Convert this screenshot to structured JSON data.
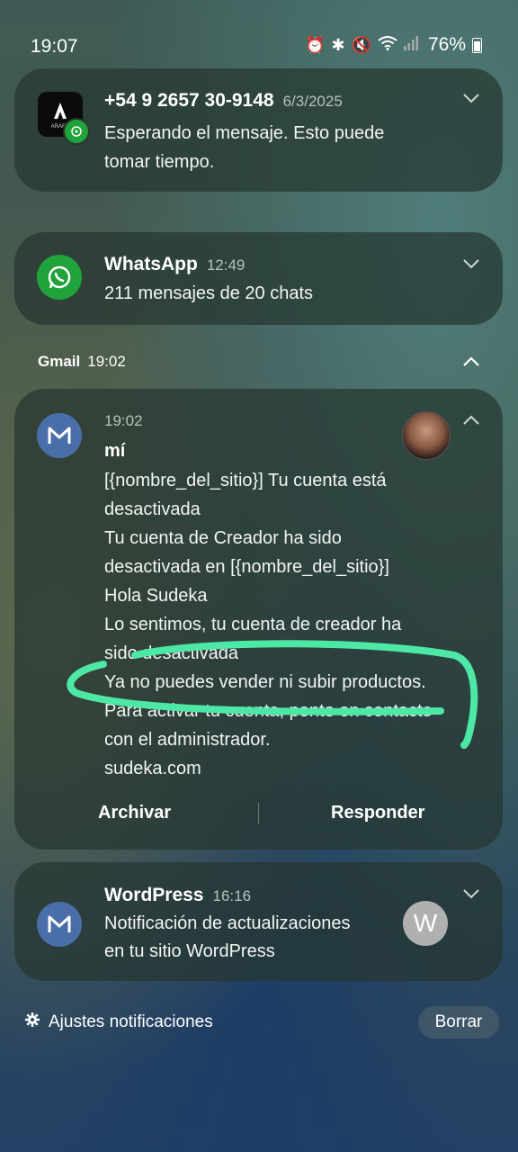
{
  "status_bar": {
    "time": "19:07",
    "battery": "76%",
    "icons": [
      "alarm-icon",
      "bluetooth-icon",
      "mute-icon",
      "wifi-icon",
      "signal-icon",
      "battery-icon"
    ]
  },
  "notifications": {
    "sms": {
      "app_icon": "arara-app-icon",
      "sender": "+54 9 2657 30-9148",
      "date": "6/3/2025",
      "body_lines": [
        "Esperando el mensaje. Esto puede",
        "tomar tiempo."
      ]
    },
    "whatsapp": {
      "app_name": "WhatsApp",
      "time": "12:49",
      "body": "211 mensajes de 20 chats"
    },
    "gmail_group": {
      "app_name": "Gmail",
      "time": "19:02"
    },
    "gmail_message": {
      "time": "19:02",
      "sender": "mí",
      "body_lines": [
        "[{nombre_del_sitio}] Tu cuenta está",
        "desactivada",
        "Tu cuenta de Creador ha sido",
        "desactivada en [{nombre_del_sitio}]",
        "Hola Sudeka",
        "Lo sentimos, tu cuenta de creador ha",
        "sido desactivada",
        "Ya no puedes vender ni subir productos.",
        "Para activar tu cuenta, ponte en contacto",
        "con el administrador.",
        "sudeka.com"
      ],
      "actions": {
        "archive": "Archivar",
        "reply": "Responder"
      }
    },
    "wordpress": {
      "app_name": "WordPress",
      "time": "16:16",
      "body_lines": [
        "Notificación de actualizaciones",
        "en tu sitio WordPress"
      ],
      "avatar_letter": "W"
    }
  },
  "footer": {
    "settings_label": "Ajustes notificaciones",
    "clear_label": "Borrar"
  },
  "colors": {
    "card_bg": "#263630",
    "whatsapp_green": "#1fa33a",
    "gmail_icon_bg": "#4a6ea8",
    "highlight_stroke": "#4de8a6"
  }
}
